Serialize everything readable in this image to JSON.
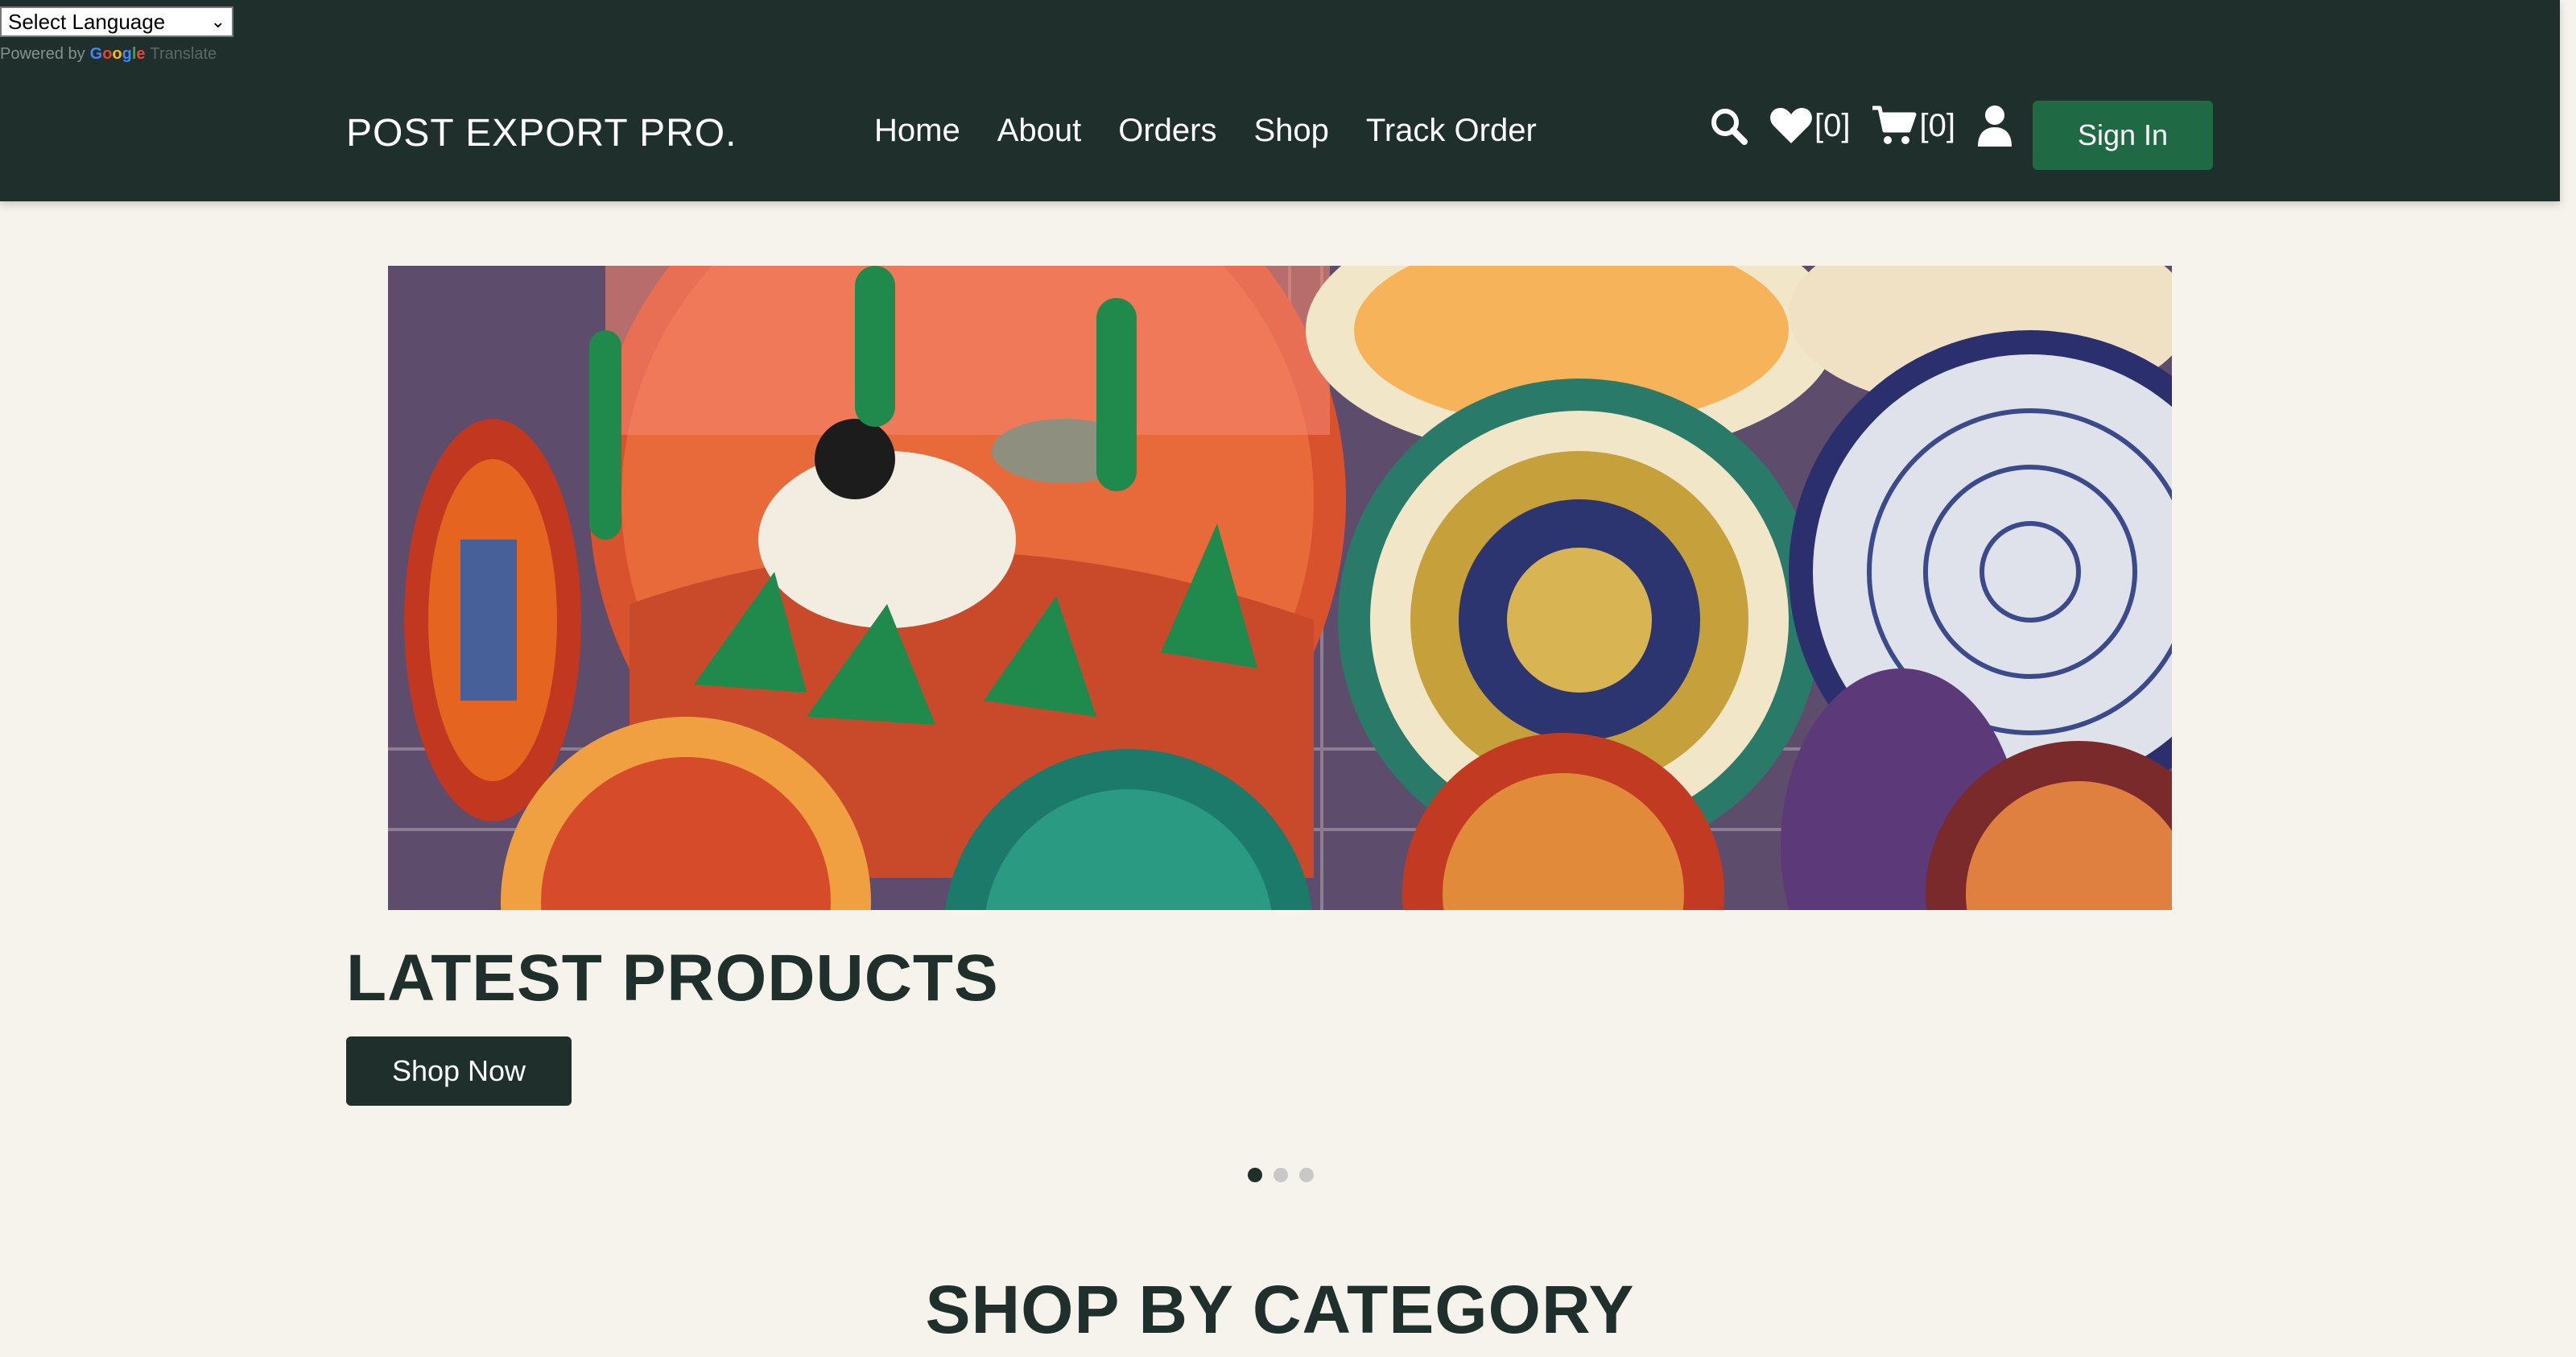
{
  "translate": {
    "select_label": "Select Language",
    "powered_by": "Powered by",
    "google": "Google",
    "translate_word": "Translate"
  },
  "header": {
    "brand": "POST EXPORT PRO.",
    "nav": [
      "Home",
      "About",
      "Orders",
      "Shop",
      "Track Order"
    ],
    "wishlist_count": "[0]",
    "cart_count": "[0]",
    "signin_label": "Sign In",
    "icons": [
      "search-icon",
      "heart-icon",
      "cart-icon",
      "user-icon"
    ]
  },
  "hero": {
    "heading": "LATEST PRODUCTS",
    "cta": "Shop Now",
    "slides": 3,
    "active_slide": 1
  },
  "category": {
    "heading": "SHOP BY CATEGORY"
  },
  "colors": {
    "header_bg": "#1f2f2b",
    "page_bg": "#f6f3ec",
    "signin_bg": "#1f6a45"
  }
}
